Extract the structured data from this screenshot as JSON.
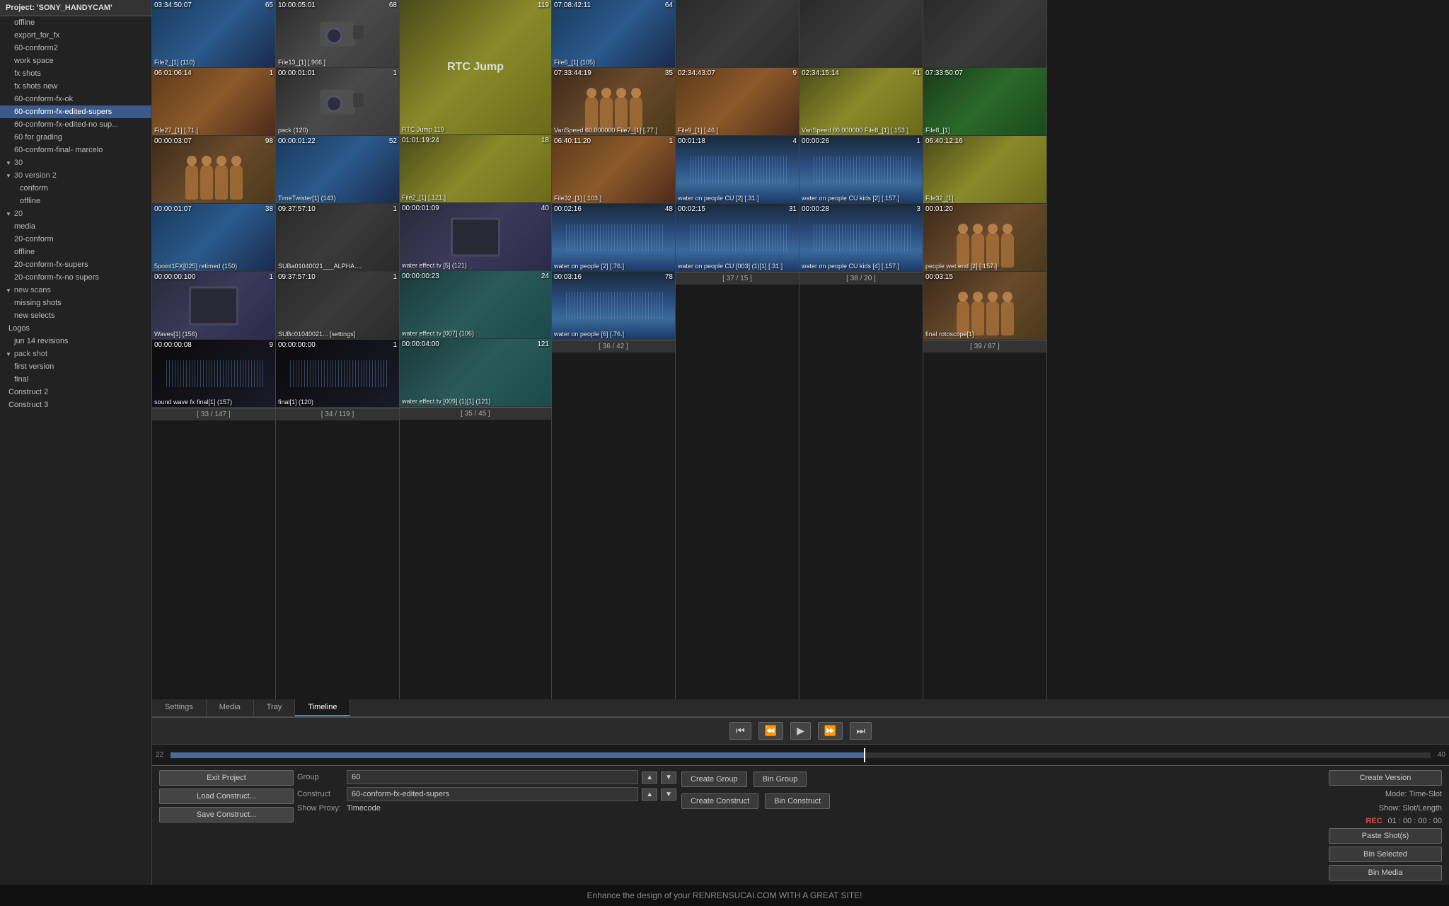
{
  "project": {
    "title": "Project: 'SONY_HANDYCAM'"
  },
  "sidebar": {
    "items": [
      {
        "label": "offline",
        "indent": 1,
        "active": false
      },
      {
        "label": "export_for_fx",
        "indent": 1,
        "active": false
      },
      {
        "label": "60-conform2",
        "indent": 1,
        "active": false
      },
      {
        "label": "work space",
        "indent": 1,
        "active": false
      },
      {
        "label": "fx shots",
        "indent": 1,
        "active": false
      },
      {
        "label": "fx shots new",
        "indent": 1,
        "active": false
      },
      {
        "label": "60-conform-fx-ok",
        "indent": 1,
        "active": false
      },
      {
        "label": "60-conform-fx-edited-supers",
        "indent": 1,
        "active": true
      },
      {
        "label": "60-conform-fx-edited-no sup...",
        "indent": 1,
        "active": false
      },
      {
        "label": "60 for grading",
        "indent": 1,
        "active": false
      },
      {
        "label": "60-conform-final- marcelo",
        "indent": 1,
        "active": false
      },
      {
        "label": "30",
        "indent": 0,
        "group": true,
        "open": true
      },
      {
        "label": "30 version 2",
        "indent": 1,
        "group": true,
        "open": true
      },
      {
        "label": "conform",
        "indent": 2,
        "active": false
      },
      {
        "label": "offline",
        "indent": 2,
        "active": false
      },
      {
        "label": "20",
        "indent": 0,
        "group": true,
        "open": true
      },
      {
        "label": "media",
        "indent": 1,
        "active": false
      },
      {
        "label": "20-conform",
        "indent": 1,
        "active": false
      },
      {
        "label": "offline",
        "indent": 1,
        "active": false
      },
      {
        "label": "20-conform-fx-supers",
        "indent": 1,
        "active": false
      },
      {
        "label": "20-conform-fx-no supers",
        "indent": 1,
        "active": false
      },
      {
        "label": "new scans",
        "indent": 0,
        "group": true,
        "open": true
      },
      {
        "label": "missing shots",
        "indent": 1,
        "active": false
      },
      {
        "label": "new selects",
        "indent": 1,
        "active": false
      },
      {
        "label": "Logos",
        "indent": 0,
        "active": false
      },
      {
        "label": "jun 14 revisions",
        "indent": 1,
        "active": false
      },
      {
        "label": "pack shot",
        "indent": 0,
        "group": true,
        "open": true
      },
      {
        "label": "first version",
        "indent": 1,
        "active": false
      },
      {
        "label": "final",
        "indent": 1,
        "active": false
      },
      {
        "label": "Construct 2",
        "indent": 0,
        "active": false
      },
      {
        "label": "Construct 3",
        "indent": 0,
        "active": false
      }
    ]
  },
  "columns": [
    {
      "footer": "[ 33 / 147 ]",
      "cells": [
        {
          "timecode": "03:34:50:07",
          "count": 65,
          "label": "File2_[1]",
          "sub": "(110)",
          "bg": "bg-blue"
        },
        {
          "timecode": "06:01:06:14",
          "count": 1,
          "label": "File27_[1]",
          "sub": "[.71.]",
          "bg": "bg-orange"
        },
        {
          "timecode": "00:00:03:07",
          "count": 98,
          "label": "",
          "sub": "",
          "bg": "bg-people"
        },
        {
          "timecode": "00:00:01:07",
          "count": 38,
          "label": "5point1FX[025] retimed",
          "sub": "(150)",
          "bg": "bg-blue"
        },
        {
          "timecode": "00:00:00:100",
          "count": 1,
          "label": "Waves[1]",
          "sub": "(156)",
          "bg": "bg-tv"
        },
        {
          "timecode": "00:00:00:08",
          "count": 9,
          "label": "sound wave fx final[1]",
          "sub": "(157)",
          "bg": "bg-dark"
        }
      ]
    },
    {
      "footer": "[ 34 / 119 ]",
      "cells": [
        {
          "timecode": "10:00:05:01",
          "count": 68,
          "label": "File13_[1]",
          "sub": "[.966.]",
          "bg": "bg-camcorder"
        },
        {
          "timecode": "00:00:01:01",
          "count": 1,
          "label": "pack",
          "sub": "(120)",
          "bg": "bg-camcorder"
        },
        {
          "timecode": "00:00:01:22",
          "count": 52,
          "label": "TimeTwister[1]",
          "sub": "(143)",
          "bg": "bg-blue"
        },
        {
          "timecode": "09:37:57:10",
          "count": 1,
          "label": "SUBa01040021___ALPHA....",
          "sub": "",
          "bg": "bg-gray"
        },
        {
          "timecode": "09:37:57:10",
          "count": 1,
          "label": "SUBc01040021... [settings]",
          "sub": "",
          "bg": "bg-gray"
        },
        {
          "timecode": "00:00:00:00",
          "count": 1,
          "label": "final[1]",
          "sub": "(120)",
          "bg": "bg-dark"
        }
      ]
    },
    {
      "footer": "[ 35 / 45 ]",
      "cells": [
        {
          "timecode": "",
          "count": 0,
          "label": "RTC Jump",
          "sub": "119",
          "bg": "bg-yellow",
          "tall": true
        },
        {
          "timecode": "01:01:19:24",
          "count": 18,
          "label": "File2_[1]",
          "sub": "[.121.]",
          "bg": "bg-yellow"
        },
        {
          "timecode": "00:00:01:09",
          "count": 40,
          "label": "water effect tv [5]",
          "sub": "(121)",
          "bg": "bg-tv"
        },
        {
          "timecode": "00:00:00:23",
          "count": 24,
          "label": "water effect tv [007]",
          "sub": "(106)",
          "bg": "bg-teal"
        },
        {
          "timecode": "00:00:04:00",
          "count": 121,
          "label": "water effect tv [009] (1)[1]",
          "sub": "(121)",
          "bg": "bg-teal"
        }
      ]
    },
    {
      "footer": "[ 36 / 42 ]",
      "cells": [
        {
          "timecode": "07:08:42:11",
          "count": 64,
          "label": "File6_[1]",
          "sub": "(105)",
          "bg": "bg-blue"
        },
        {
          "timecode": "07:33:44:19",
          "count": 35,
          "label": "VariSpeed 60.000000\nFile7_[1]",
          "sub": "[.77.]",
          "bg": "bg-people"
        },
        {
          "timecode": "06:40:11:20",
          "count": 1,
          "label": "File32_[1]",
          "sub": "[.103.]",
          "bg": "bg-orange"
        },
        {
          "timecode": "00:02:16",
          "count": 48,
          "label": "water on people [2]",
          "sub": "[.76.]",
          "bg": "bg-water"
        },
        {
          "timecode": "00:03:16",
          "count": 78,
          "label": "water on people [6]",
          "sub": "[.76.]",
          "bg": "bg-water"
        }
      ]
    },
    {
      "footer": "[ 37 / 15 ]",
      "cells": [
        {
          "timecode": "",
          "count": 0,
          "label": "",
          "sub": "",
          "bg": "bg-gray"
        },
        {
          "timecode": "02:34:43:07",
          "count": 9,
          "label": "File9_[1]",
          "sub": "[.46.]",
          "bg": "bg-orange"
        },
        {
          "timecode": "00:01:18",
          "count": 4,
          "label": "water on people CU [2]",
          "sub": "[.31.]",
          "bg": "bg-water"
        },
        {
          "timecode": "00:02:15",
          "count": 31,
          "label": "water on people CU [003] (1)[1]",
          "sub": "[.31.]",
          "bg": "bg-water"
        }
      ]
    },
    {
      "footer": "[ 38 / 20 ]",
      "cells": [
        {
          "timecode": "",
          "count": 0,
          "label": "",
          "sub": "",
          "bg": "bg-gray"
        },
        {
          "timecode": "02:34:15:14",
          "count": 41,
          "label": "VariSpeed 60.000000\nFile8_[1]",
          "sub": "[.153.]",
          "bg": "bg-yellow"
        },
        {
          "timecode": "00:00:26",
          "count": 1,
          "label": "water on people CU kids [2]",
          "sub": "[.157.]",
          "bg": "bg-water"
        },
        {
          "timecode": "00:00:28",
          "count": 3,
          "label": "water on people CU kids [4]",
          "sub": "[.157.]",
          "bg": "bg-water"
        }
      ]
    },
    {
      "footer": "[ 39 / 87 ]",
      "cells": [
        {
          "timecode": "",
          "count": 0,
          "label": "",
          "sub": "",
          "bg": "bg-gray"
        },
        {
          "timecode": "07:33:50:07",
          "count": 0,
          "label": "File8_[1]",
          "sub": "",
          "bg": "bg-green"
        },
        {
          "timecode": "06:40:12:16",
          "count": 0,
          "label": "File32_[1]",
          "sub": "",
          "bg": "bg-yellow"
        },
        {
          "timecode": "00:01:20",
          "count": 0,
          "label": "people wet end [2]",
          "sub": "[.157.]",
          "bg": "bg-people"
        },
        {
          "timecode": "00:03:15",
          "count": 0,
          "label": "final rotoscope[1]",
          "sub": "",
          "bg": "bg-people"
        }
      ]
    }
  ],
  "bottom_tabs": [
    {
      "label": "Settings",
      "active": false
    },
    {
      "label": "Media",
      "active": false
    },
    {
      "label": "Tray",
      "active": false
    },
    {
      "label": "Timeline",
      "active": true
    }
  ],
  "controls": {
    "group_label": "Group",
    "group_value": "60",
    "construct_label": "Construct",
    "construct_value": "60-conform-fx-edited-supers",
    "proxy_label": "Show Proxy:",
    "proxy_value": "Timecode",
    "create_group": "Create Group",
    "bin_group": "Bin Group",
    "create_construct": "Create Construct",
    "bin_construct": "Bin Construct",
    "mode_label": "Mode: Time-Slot",
    "show_label": "Show: Slot/Length",
    "rec_label": "REC",
    "rec_value": "01 : 00 : 00 : 00",
    "create_version": "Create Version",
    "paste_shots": "Paste Shot(s)",
    "bin_selected": "Bin Selected",
    "bin_media": "Bin Media"
  },
  "left_btns": {
    "exit_project": "Exit Project",
    "load_construct": "Load Construct...",
    "save_construct": "Save Construct..."
  },
  "timeline": {
    "start": "22",
    "end": "40",
    "cursor_pct": 55
  },
  "transport": {
    "rewind": "⏮",
    "prev": "⏭",
    "play": "▶",
    "next": "⏭",
    "ff": "⏭"
  }
}
